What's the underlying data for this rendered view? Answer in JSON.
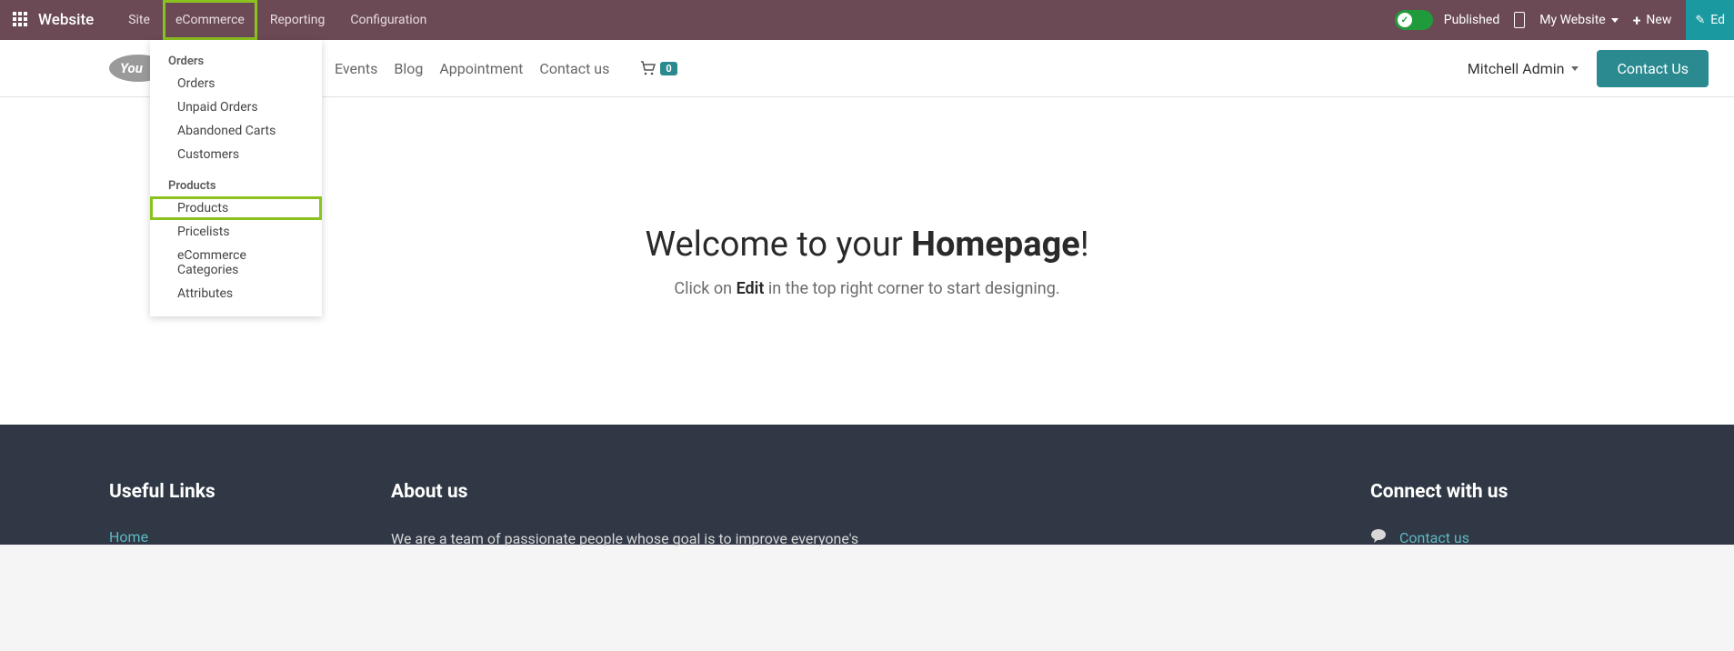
{
  "topbar": {
    "brand": "Website",
    "nav": [
      "Site",
      "eCommerce",
      "Reporting",
      "Configuration"
    ],
    "published": "Published",
    "my_website": "My Website",
    "new": "New",
    "edit": "Ed"
  },
  "dropdown": {
    "group1_header": "Orders",
    "group1": [
      "Orders",
      "Unpaid Orders",
      "Abandoned Carts",
      "Customers"
    ],
    "group2_header": "Products",
    "group2": [
      "Products",
      "Pricelists",
      "eCommerce Categories",
      "Attributes"
    ]
  },
  "sitenav": [
    "Events",
    "Blog",
    "Appointment",
    "Contact us"
  ],
  "cart_count": "0",
  "user": "Mitchell Admin",
  "contact_btn": "Contact Us",
  "hero": {
    "welcome_pre": "Welcome to your ",
    "welcome_bold": "Homepage",
    "welcome_post": "!",
    "sub_pre": "Click on ",
    "sub_bold": "Edit",
    "sub_post": " in the top right corner to start designing."
  },
  "footer": {
    "links_title": "Useful Links",
    "links": [
      "Home"
    ],
    "about_title": "About us",
    "about_text": "We are a team of passionate people whose goal is to improve everyone's",
    "connect_title": "Connect with us",
    "connect_link": "Contact us"
  }
}
